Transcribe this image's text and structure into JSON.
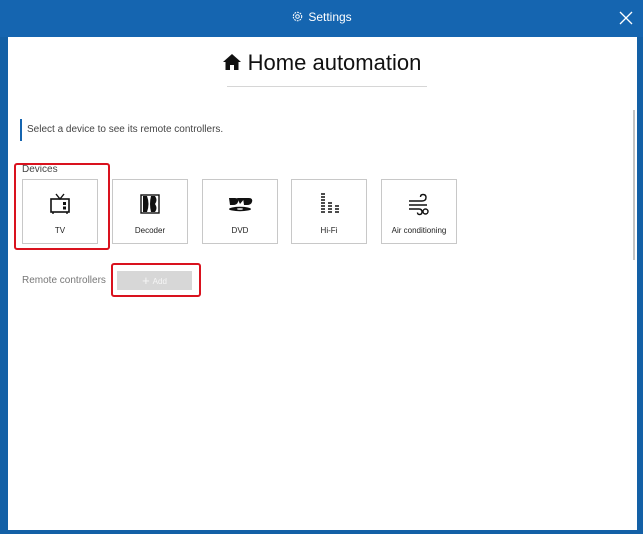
{
  "window": {
    "title": "Settings",
    "accent_color": "#1565b0",
    "highlight_color": "#d9121e"
  },
  "page": {
    "title": "Home automation",
    "title_icon": "home-icon"
  },
  "hint": {
    "text": "Select a device to see its remote controllers."
  },
  "devices": {
    "label": "Devices",
    "items": [
      {
        "label": "TV",
        "icon": "tv-icon",
        "highlighted": true
      },
      {
        "label": "Decoder",
        "icon": "decoder-icon",
        "highlighted": false
      },
      {
        "label": "DVD",
        "icon": "dvd-icon",
        "highlighted": false
      },
      {
        "label": "Hi-Fi",
        "icon": "hifi-icon",
        "highlighted": false
      },
      {
        "label": "Air conditioning",
        "icon": "air-conditioning-icon",
        "highlighted": false
      }
    ]
  },
  "remote_controllers": {
    "label": "Remote controllers",
    "add_label": "Add",
    "add_icon": "plus-icon"
  }
}
